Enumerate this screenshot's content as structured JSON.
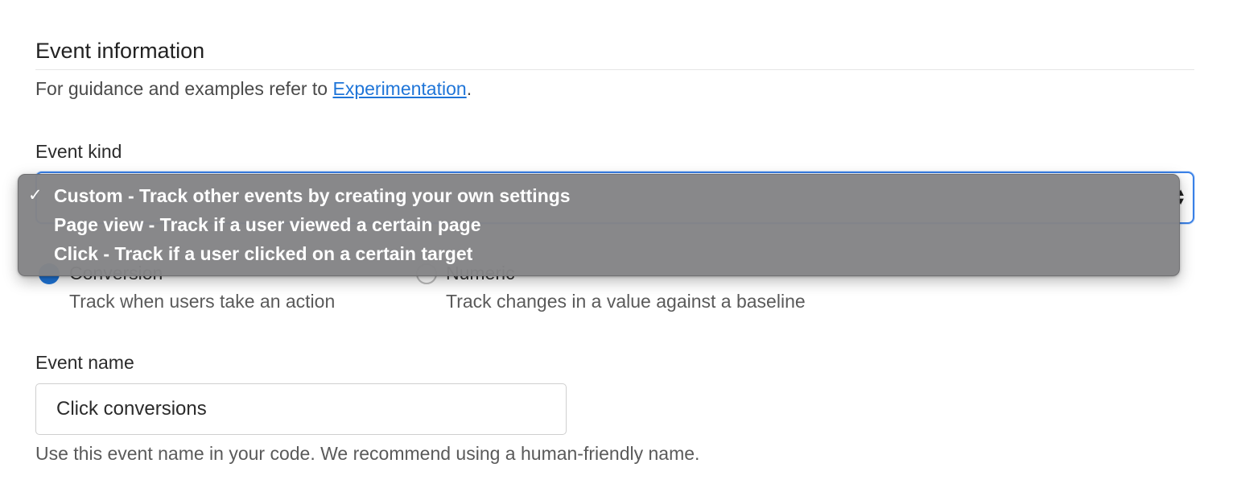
{
  "section": {
    "title": "Event information",
    "guidance_prefix": "For guidance and examples refer to ",
    "guidance_link": "Experimentation",
    "guidance_suffix": "."
  },
  "event_kind": {
    "label": "Event kind",
    "selected": "Custom - Track other events by creating your own settings",
    "options": [
      {
        "label": "Custom - Track other events by creating your own settings",
        "checked": true
      },
      {
        "label": "Page view - Track if a user viewed a certain page",
        "checked": false
      },
      {
        "label": "Click - Track if a user clicked on a certain target",
        "checked": false
      }
    ],
    "check_glyph": "✓",
    "arrows_glyph_up": "▲",
    "arrows_glyph_down": "▼"
  },
  "metric_type": {
    "options": [
      {
        "label": "Conversion",
        "help": "Track when users take an action",
        "selected": true
      },
      {
        "label": "Numeric",
        "help": "Track changes in a value against a baseline",
        "selected": false
      }
    ]
  },
  "event_name": {
    "label": "Event name",
    "value": "Click conversions",
    "help": "Use this event name in your code. We recommend using a human-friendly name."
  },
  "colors": {
    "accent": "#1f75d8",
    "focus_ring": "#3b82e8",
    "dropdown_bg": "#848486"
  }
}
